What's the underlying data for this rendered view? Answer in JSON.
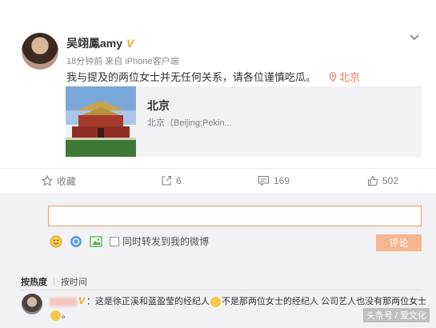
{
  "post": {
    "username": "吴翊鳳amy",
    "vip": "V",
    "meta": "18分钟前 来自 iPhone客户端",
    "text": "我与提及的两位女士并无任何关系，请各位谨慎吃瓜。",
    "location": "北京"
  },
  "place_card": {
    "name": "北京",
    "desc": "北京（Beijing;Pekin..."
  },
  "actions": {
    "favorite": "收藏",
    "forward": "6",
    "comment": "169",
    "like": "502"
  },
  "comment_box": {
    "input_value": "",
    "repost_label": "同时转发到我的微博",
    "submit_label": "评论"
  },
  "sort": {
    "hot": "按热度",
    "time": "按时间"
  },
  "comment": {
    "vip": "V",
    "text_a": "：这是徐正溪和蓝盈莹的经纪人",
    "text_b": "不是那两位女士的经纪人 公司艺人也没有那两位女士",
    "text_c": "。"
  },
  "watermark": "头条号 / 爱文化",
  "colors": {
    "accent": "#eb7350",
    "vip": "#f5a623",
    "submit_bg": "#f5b58e",
    "panel_bg": "#f2f2f5"
  },
  "icons": [
    "chevron-down-icon",
    "location-pin-icon",
    "star-icon",
    "forward-icon",
    "comment-icon",
    "thumbs-up-icon",
    "emoji-icon",
    "topic-icon",
    "image-icon"
  ]
}
